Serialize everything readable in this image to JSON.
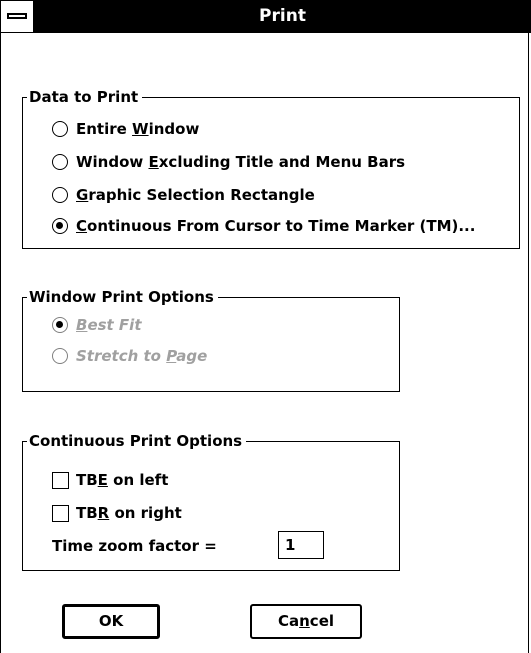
{
  "window": {
    "title": "Print"
  },
  "data_to_print": {
    "label": "Data to Print",
    "options": [
      {
        "pre": "Entire ",
        "key": "W",
        "post": "indow",
        "checked": false
      },
      {
        "pre": "Window ",
        "key": "E",
        "post": "xcluding Title and Menu Bars",
        "checked": false
      },
      {
        "pre": "",
        "key": "G",
        "post": "raphic Selection Rectangle",
        "checked": false
      },
      {
        "pre": "",
        "key": "C",
        "post": "ontinuous From Cursor to Time Marker (TM)...",
        "checked": true
      }
    ]
  },
  "window_print_options": {
    "label": "Window Print Options",
    "enabled": false,
    "options": [
      {
        "pre": "",
        "key": "B",
        "post": "est Fit",
        "checked": true
      },
      {
        "pre": "Stretch to ",
        "key": "P",
        "post": "age",
        "checked": false
      }
    ]
  },
  "continuous_print_options": {
    "label": "Continuous Print Options",
    "tbe": {
      "pre": "TB",
      "key": "E",
      "post": " on left",
      "checked": false
    },
    "tbr": {
      "pre": "TB",
      "key": "R",
      "post": " on right",
      "checked": false
    },
    "zoom": {
      "label": "Time zoom factor =",
      "value": "1"
    }
  },
  "buttons": {
    "ok": {
      "label": "OK"
    },
    "cancel": {
      "pre": "Ca",
      "key": "n",
      "post": "cel"
    }
  }
}
